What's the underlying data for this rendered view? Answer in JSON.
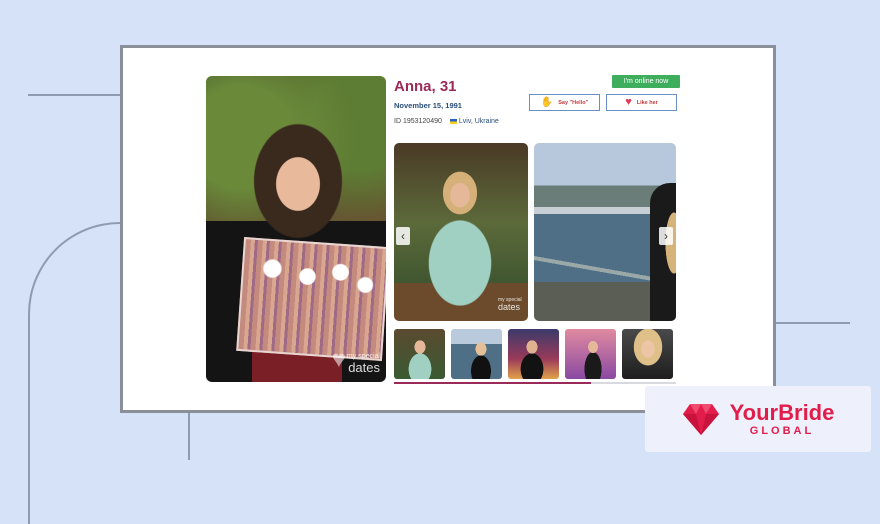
{
  "profile": {
    "name_age": "Anna, 31",
    "birth_date": "November 15, 1991",
    "id_text": "ID 1953120490",
    "location": "Lviv, Ukraine",
    "online_status": "I'm online now"
  },
  "actions": {
    "say_hello_label": "Say \"Hello\"",
    "like_label": "Like her"
  },
  "photos": {
    "watermark_small": "my special",
    "watermark_big": "dates",
    "gallery_progress": 0.7
  },
  "brand": {
    "name": "YourBride",
    "subtitle": "GLOBAL",
    "color": "#e21d4b"
  },
  "colors": {
    "online_badge": "#3fae5c",
    "name": "#9a2a58",
    "link": "#2a4e7c"
  },
  "icons": [
    "wave-hand-icon",
    "heart-icon",
    "chevron-left-icon",
    "chevron-right-icon",
    "ukraine-flag-icon",
    "diamond-logo-icon"
  ]
}
